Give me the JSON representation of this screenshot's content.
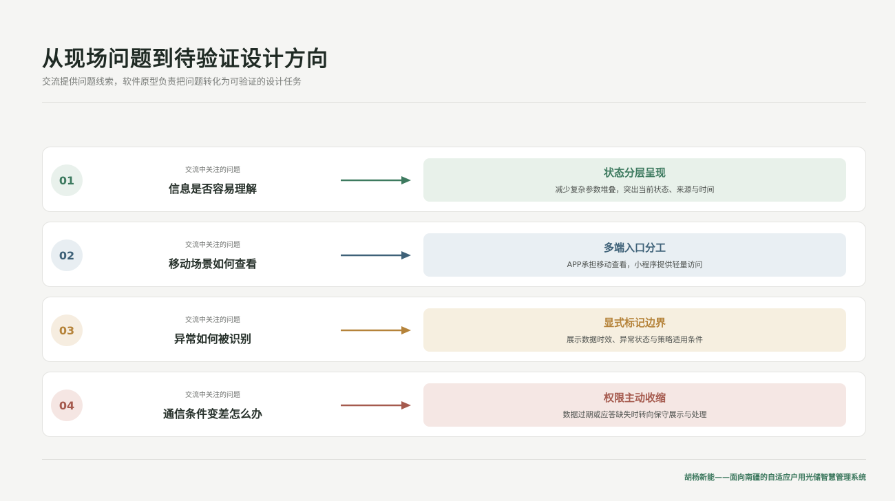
{
  "header": {
    "title": "从现场问题到待验证设计方向",
    "subtitle": "交流提供问题线索，软件原型负责把问题转化为可验证的设计任务"
  },
  "rows": [
    {
      "number": "01",
      "question_label": "交流中关注的问题",
      "question": "信息是否容易理解",
      "answer_title": "状态分层呈现",
      "answer_desc": "减少复杂参数堆叠，突出当前状态、来源与时间",
      "accent": "#3d7a5f",
      "circle_bg": "#e9f1ec",
      "card_bg": "#e8f1ea"
    },
    {
      "number": "02",
      "question_label": "交流中关注的问题",
      "question": "移动场景如何查看",
      "answer_title": "多端入口分工",
      "answer_desc": "APP承担移动查看，小程序提供轻量访问",
      "accent": "#3e6178",
      "circle_bg": "#e8eef2",
      "card_bg": "#e9eff3"
    },
    {
      "number": "03",
      "question_label": "交流中关注的问题",
      "question": "异常如何被识别",
      "answer_title": "显式标记边界",
      "answer_desc": "展示数据时效、异常状态与策略适用条件",
      "accent": "#b5833a",
      "circle_bg": "#f6ede0",
      "card_bg": "#f6efe0"
    },
    {
      "number": "04",
      "question_label": "交流中关注的问题",
      "question": "通信条件变差怎么办",
      "answer_title": "权限主动收缩",
      "answer_desc": "数据过期或应答缺失时转向保守展示与处理",
      "accent": "#a55a4e",
      "circle_bg": "#f5e6e3",
      "card_bg": "#f5e7e4"
    }
  ],
  "footer": {
    "text": "胡杨新能——面向南疆的自适应户用光储智慧管理系统"
  }
}
